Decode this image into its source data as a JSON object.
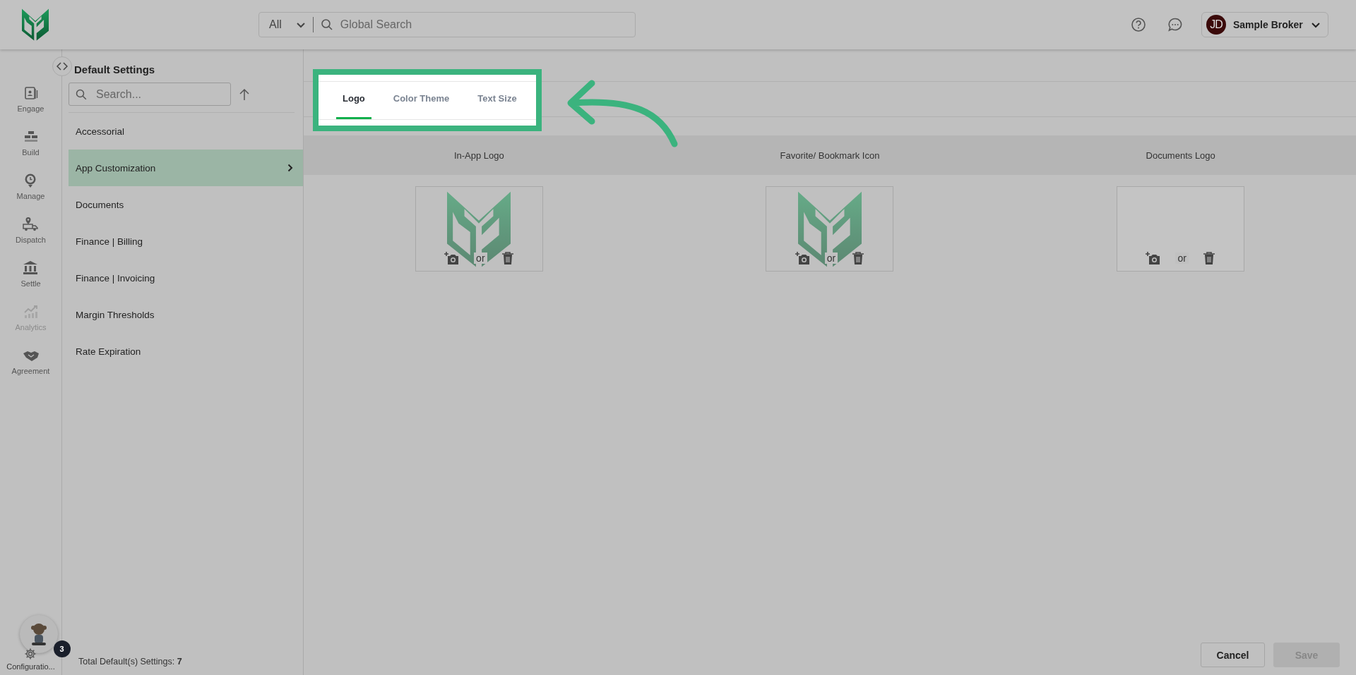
{
  "header": {
    "search_scope": "All",
    "search_placeholder": "Global Search",
    "user": {
      "initials": "JD",
      "name": "Sample Broker"
    }
  },
  "rail": {
    "items": [
      {
        "label": "Engage",
        "disabled": false
      },
      {
        "label": "Build",
        "disabled": false
      },
      {
        "label": "Manage",
        "disabled": false
      },
      {
        "label": "Dispatch",
        "disabled": false
      },
      {
        "label": "Settle",
        "disabled": false
      },
      {
        "label": "Analytics",
        "disabled": true
      },
      {
        "label": "Agreement",
        "disabled": false
      }
    ],
    "config_label": "Configuratio...",
    "badge": "3"
  },
  "settings": {
    "title": "Default Settings",
    "search_placeholder": "Search...",
    "items": [
      {
        "label": "Accessorial",
        "selected": false
      },
      {
        "label": "App Customization",
        "selected": true
      },
      {
        "label": "Documents",
        "selected": false
      },
      {
        "label": "Finance | Billing",
        "selected": false
      },
      {
        "label": "Finance | Invoicing",
        "selected": false
      },
      {
        "label": "Margin Thresholds",
        "selected": false
      },
      {
        "label": "Rate Expiration",
        "selected": false
      }
    ],
    "footer": "Total Default(s) Settings: **7**"
  },
  "tabs": [
    {
      "label": "Logo",
      "selected": true
    },
    {
      "label": "Color Theme",
      "selected": false
    },
    {
      "label": "Text Size",
      "selected": false
    }
  ],
  "logos": [
    {
      "title": "In-App Logo",
      "has_image": true,
      "separator": "or"
    },
    {
      "title": "Favorite/ Bookmark Icon",
      "has_image": true,
      "separator": "or"
    },
    {
      "title": "Documents Logo",
      "has_image": false,
      "separator": "or"
    }
  ],
  "buttons": [
    {
      "label": "Cancel",
      "disabled": false
    },
    {
      "label": "Save",
      "disabled": true
    }
  ]
}
